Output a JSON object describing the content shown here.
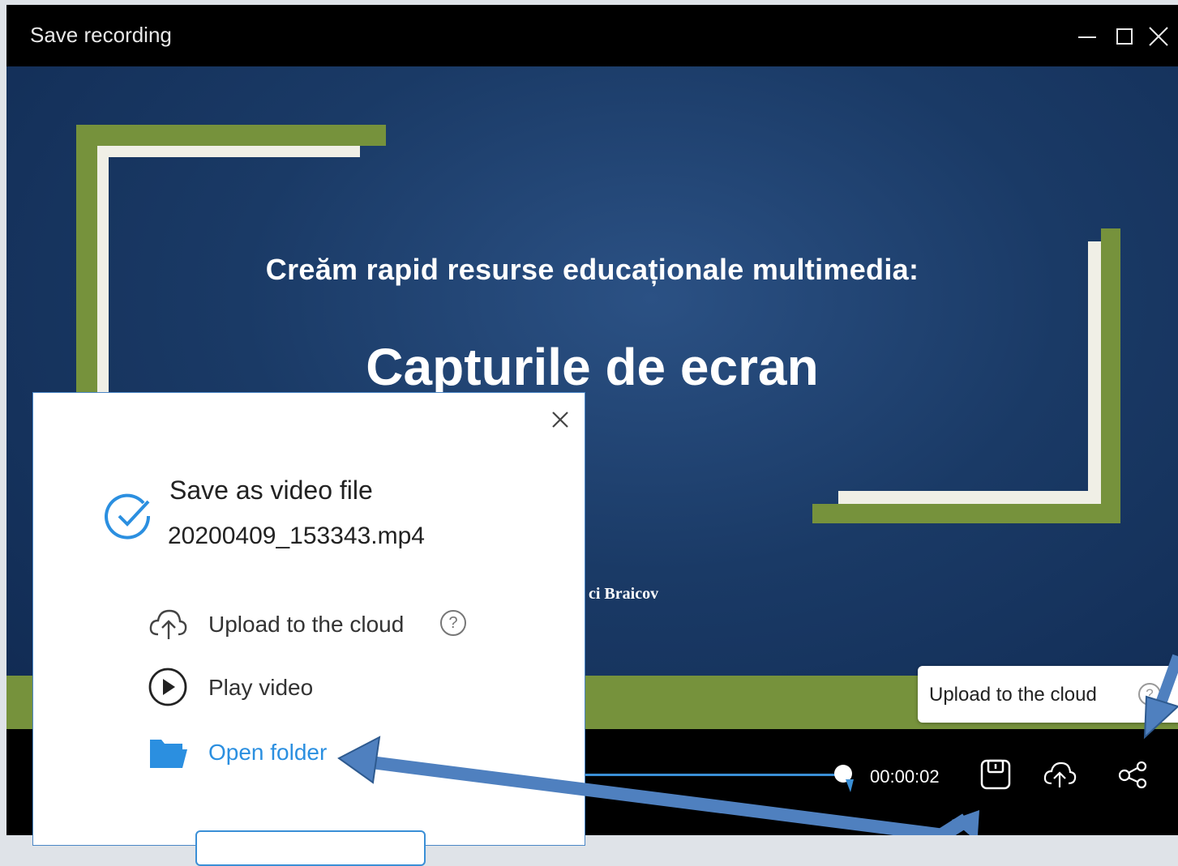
{
  "window": {
    "title": "Save recording"
  },
  "slide": {
    "subtitle": "Creăm rapid resurse educaționale multimedia:",
    "title": "Capturile de ecran",
    "author_fragment": "ci Braicov"
  },
  "player": {
    "timecode": "00:00:02",
    "progress": 1.0
  },
  "tooltip": {
    "text": "Upload to the cloud",
    "help_glyph": "?"
  },
  "dialog": {
    "heading": "Save as video file",
    "filename": "20200409_153343.mp4",
    "actions": [
      {
        "label": "Upload to the cloud",
        "icon": "cloud-upload-icon"
      },
      {
        "label": "Play video",
        "icon": "play-circle-icon"
      },
      {
        "label": "Open folder",
        "icon": "folder-icon"
      }
    ],
    "help_glyph": "?"
  },
  "colors": {
    "accent_blue": "#2b8fe0",
    "slide_green": "#76923c",
    "slide_cream": "#f0efe6",
    "arrow_blue": "#4f80bf",
    "slide_bg": "#1a3a66"
  }
}
